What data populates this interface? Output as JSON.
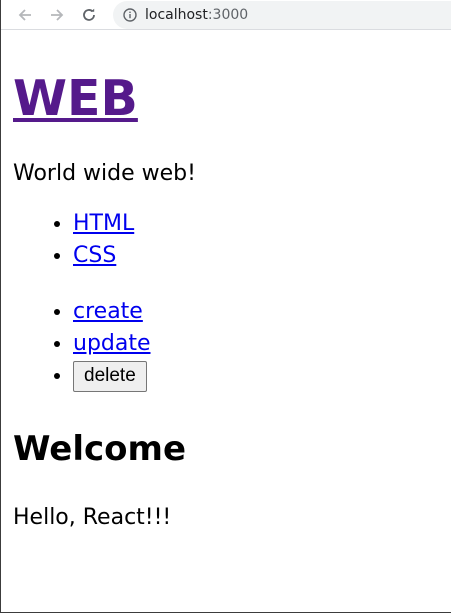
{
  "browser": {
    "url_host": "localhost",
    "url_port": ":3000"
  },
  "header": {
    "title": "WEB"
  },
  "intro": "World wide web!",
  "topics": [
    {
      "label": "HTML"
    },
    {
      "label": "CSS"
    }
  ],
  "controls": {
    "create_label": "create",
    "update_label": "update",
    "delete_label": "delete"
  },
  "article": {
    "title": "Welcome",
    "body": "Hello, React!!!"
  },
  "colors": {
    "visited_link": "#551a8b",
    "link": "#0000ee"
  }
}
